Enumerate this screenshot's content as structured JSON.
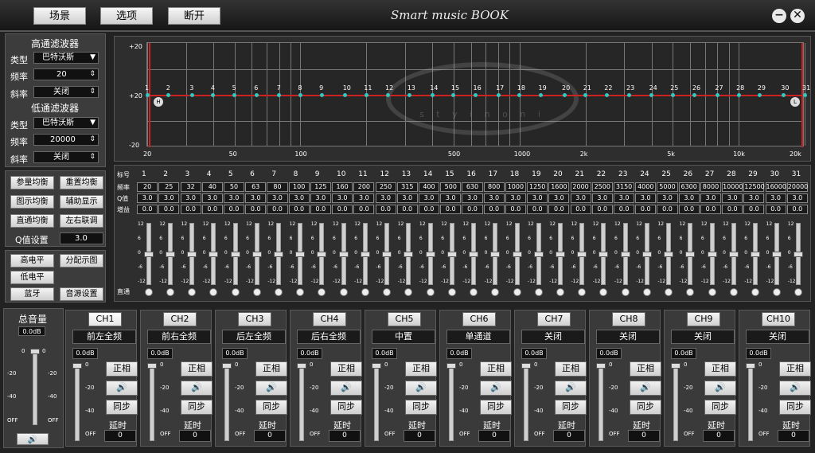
{
  "app": {
    "title": "Smart music BOOK"
  },
  "menu": {
    "items": [
      "场景",
      "选项",
      "断开"
    ]
  },
  "window": {
    "minimize": "−",
    "close": "✕"
  },
  "left": {
    "hp_title": "高通滤波器",
    "lp_title": "低通滤波器",
    "type_label": "类型",
    "freq_label": "频率",
    "slope_label": "斜率",
    "hp_type": "巴特沃斯",
    "hp_freq": "20",
    "hp_slope": "关闭",
    "lp_type": "巴特沃斯",
    "lp_freq": "20000",
    "lp_slope": "关闭",
    "buttons": [
      "参量均衡",
      "重置均衡",
      "图示均衡",
      "辅助显示",
      "直通均衡",
      "左右联调"
    ],
    "q_label": "Q值设置",
    "q_value": "3.0",
    "buttons2": [
      "高电平",
      "分配示图",
      "低电平",
      "蓝牙",
      "音源设置"
    ]
  },
  "eq": {
    "y_labels": [
      "+20",
      "+20",
      "-20"
    ],
    "x_labels": [
      "20",
      "50",
      "100",
      "500",
      "1000",
      "2k",
      "5k",
      "10k",
      "20k"
    ],
    "watermark": "s t y i n o n i",
    "markers": [
      "H",
      "L"
    ],
    "points": 31
  },
  "table": {
    "row_labels": [
      "标号",
      "频率",
      "Q值",
      "增益",
      "直通"
    ],
    "numbers": [
      "1",
      "2",
      "3",
      "4",
      "5",
      "6",
      "7",
      "8",
      "9",
      "10",
      "11",
      "12",
      "13",
      "14",
      "15",
      "16",
      "17",
      "18",
      "19",
      "20",
      "21",
      "22",
      "23",
      "24",
      "25",
      "26",
      "27",
      "28",
      "29",
      "30",
      "31"
    ],
    "freqs": [
      "20",
      "25",
      "32",
      "40",
      "50",
      "63",
      "80",
      "100",
      "125",
      "160",
      "200",
      "250",
      "315",
      "400",
      "500",
      "630",
      "800",
      "1000",
      "1250",
      "1600",
      "2000",
      "2500",
      "3150",
      "4000",
      "5000",
      "6300",
      "8000",
      "10000",
      "12500",
      "16000",
      "20000"
    ],
    "q": "3.0",
    "gain": "0.0",
    "fader_scale": [
      "12",
      "6",
      "0",
      "-6",
      "-12"
    ]
  },
  "master": {
    "title": "总音量",
    "db": "0.0dB",
    "scale": [
      "0",
      "-20",
      "-40",
      "OFF"
    ]
  },
  "channel_common": {
    "db": "0.0dB",
    "phase": "正相",
    "sync": "同步",
    "delay_label": "延时",
    "delay": "0",
    "scale": [
      "0",
      "-20",
      "-40",
      "OFF"
    ]
  },
  "channels": [
    {
      "name": "CH1",
      "src": "前左全频"
    },
    {
      "name": "CH2",
      "src": "前右全频"
    },
    {
      "name": "CH3",
      "src": "后左全频"
    },
    {
      "name": "CH4",
      "src": "后右全频"
    },
    {
      "name": "CH5",
      "src": "中置"
    },
    {
      "name": "CH6",
      "src": "单通道"
    },
    {
      "name": "CH7",
      "src": "关闭"
    },
    {
      "name": "CH8",
      "src": "关闭"
    },
    {
      "name": "CH9",
      "src": "关闭"
    },
    {
      "name": "CH10",
      "src": "关闭"
    }
  ],
  "colors": {
    "curve": "#cc2222",
    "point": "#2fc9c1",
    "accent": "#e9e9e9"
  }
}
